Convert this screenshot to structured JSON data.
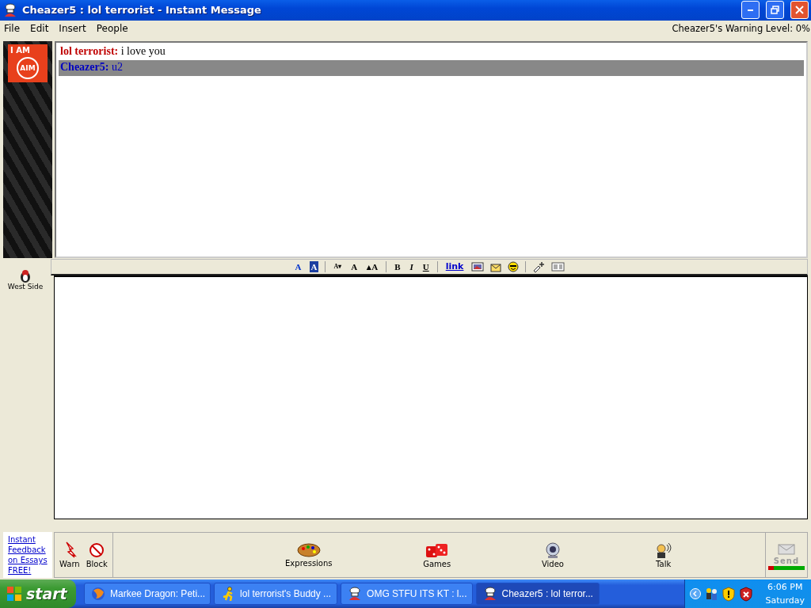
{
  "window": {
    "title": "Cheazer5 : lol terrorist - Instant Message"
  },
  "menu": [
    "File",
    "Edit",
    "Insert",
    "People"
  ],
  "warning_level": "Cheazer5's Warning Level: 0%",
  "badge": {
    "line1": "I AM",
    "line2": "AIM"
  },
  "messages": [
    {
      "sender": "lol terrorist:",
      "text": "i love you",
      "color": "#c00000",
      "selected": false
    },
    {
      "sender": "Cheazer5:",
      "text": "u2",
      "color": "#0000c0",
      "selected": true
    }
  ],
  "buddy": {
    "name": "West Side"
  },
  "format_toolbar": [
    {
      "kind": "glyph",
      "text": "A"
    },
    {
      "kind": "glyph",
      "text": "A"
    },
    {
      "kind": "sep"
    },
    {
      "kind": "glyph",
      "text": "A▾"
    },
    {
      "kind": "glyph",
      "text": "A"
    },
    {
      "kind": "glyph",
      "text": "▴A"
    },
    {
      "kind": "sep"
    },
    {
      "kind": "glyph",
      "text": "B"
    },
    {
      "kind": "glyph",
      "text": "I"
    },
    {
      "kind": "glyph",
      "text": "U"
    },
    {
      "kind": "sep"
    },
    {
      "kind": "glyph",
      "text": "link"
    },
    {
      "kind": "icon"
    },
    {
      "kind": "icon"
    },
    {
      "kind": "icon"
    },
    {
      "kind": "sep"
    },
    {
      "kind": "icon"
    },
    {
      "kind": "icon"
    }
  ],
  "ad_link": "Instant Feedback on Essays FREE!",
  "left_actions": [
    {
      "label": "Warn"
    },
    {
      "label": "Block"
    }
  ],
  "center_actions": [
    {
      "label": "Expressions"
    },
    {
      "label": "Games"
    },
    {
      "label": "Video"
    },
    {
      "label": "Talk"
    }
  ],
  "send": {
    "label": "Send",
    "level": 0.15
  },
  "taskbar": {
    "start": "start",
    "tasks": [
      {
        "label": "Markee Dragon: Peti...",
        "selected": false
      },
      {
        "label": "lol terrorist's Buddy ...",
        "selected": false
      },
      {
        "label": "OMG STFU ITS KT : l...",
        "selected": false
      },
      {
        "label": "Cheazer5 : lol terror...",
        "selected": true
      }
    ],
    "time": "6:06 PM",
    "day": "Saturday"
  }
}
